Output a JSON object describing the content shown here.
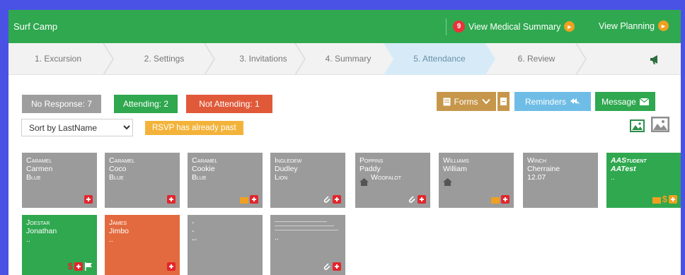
{
  "header": {
    "title": "Surf Camp",
    "medical_badge": "9",
    "medical_label": "View Medical Summary",
    "planning_label": "View Planning"
  },
  "wizard": {
    "steps": [
      "1. Excursion",
      "2. Settings",
      "3. Invitations",
      "4. Summary",
      "5. Attendance",
      "6. Review"
    ],
    "active_step": "5. Attendance"
  },
  "counts": {
    "no_response": "No Response: 7",
    "attending": "Attending: 2",
    "not_attending": "Not Attending: 1"
  },
  "actions": {
    "forms": "Forms",
    "reminders": "Reminders",
    "message": "Message"
  },
  "sort": {
    "selected": "Sort by LastName"
  },
  "rsvp_note": "RSVP has already past",
  "icons": {
    "medical": "medical-kit-icon",
    "envelope": "envelope-icon",
    "paperclip": "paperclip-icon",
    "home": "home-icon",
    "flag": "flag-icon",
    "image": "image-icon",
    "megaphone": "megaphone-icon"
  },
  "colors": {
    "header": "#2fa84f",
    "card_default": "#9b9b9b",
    "card_attending": "#2fa84f",
    "card_not_attending": "#e36a3e",
    "medical": "#e3262c",
    "envelope": "#f0a020"
  },
  "cards": [
    {
      "line1": "Caramel",
      "line2": "Carmen",
      "line3": "Blue",
      "line4": ""
    },
    {
      "line1": "Caramel",
      "line2": "Coco",
      "line3": "Blue",
      "line4": ""
    },
    {
      "line1": "Caramel",
      "line2": "Cookie",
      "line3": "Blue",
      "line4": ""
    },
    {
      "line1": "Ingledew",
      "line2": "Dudley",
      "line3": "Lion",
      "line4": ""
    },
    {
      "line1": "Poppins",
      "line2": "Paddy",
      "line3": "Woofalot",
      "line4": ""
    },
    {
      "line1": "Williams",
      "line2": "William",
      "line3": "",
      "line4": ""
    },
    {
      "line1": "Winch",
      "line2": "Cherraine",
      "line3": "12.07",
      "line4": ""
    },
    {
      "line1": "AAStudent",
      "line2": "AATest",
      "line3": "..",
      "line4": ""
    },
    {
      "line1": "Joestar",
      "line2": "Jonathan",
      "line3": "..",
      "line4": ""
    },
    {
      "line1": "James",
      "line2": "Jimbo",
      "line3": "..",
      "line4": ""
    },
    {
      "line1": "-",
      "line2": "-",
      "line3": "--",
      "line4": ""
    },
    {
      "line1": "",
      "line2": "",
      "line3": "",
      "line4": ".."
    }
  ]
}
